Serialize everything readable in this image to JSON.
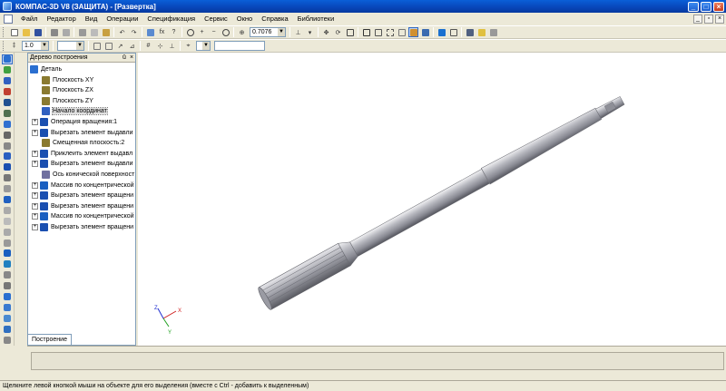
{
  "window": {
    "title": "КОМПАС-3D V8 (ЗАЩИТА) - [Развертка]"
  },
  "menu": {
    "items": [
      "Файл",
      "Редактор",
      "Вид",
      "Операции",
      "Спецификация",
      "Сервис",
      "Окно",
      "Справка",
      "Библиотеки"
    ]
  },
  "toolbar": {
    "zoom_value": "0.7076",
    "step_value": "1.0"
  },
  "tree": {
    "title": "Дерево построения",
    "items": [
      {
        "label": "Деталь",
        "icon": "part-icon",
        "color": "#2a6fd0"
      },
      {
        "label": "Плоскость XY",
        "icon": "plane-icon",
        "color": "#8a7a30"
      },
      {
        "label": "Плоскость ZX",
        "icon": "plane-icon",
        "color": "#8a7a30"
      },
      {
        "label": "Плоскость ZY",
        "icon": "plane-icon",
        "color": "#8a7a30"
      },
      {
        "label": "Начало координат",
        "icon": "origin-icon",
        "color": "#3060c0"
      },
      {
        "label": "Операция вращения:1",
        "icon": "revolve-icon",
        "color": "#1a4fb0"
      },
      {
        "label": "Вырезать элемент выдавли",
        "icon": "cut-extrude-icon",
        "color": "#1a4fb0"
      },
      {
        "label": "Смещенная плоскость:2",
        "icon": "plane-icon",
        "color": "#8a7a30"
      },
      {
        "label": "Приклеить элемент выдавл",
        "icon": "extrude-icon",
        "color": "#1a4fb0"
      },
      {
        "label": "Вырезать элемент выдавли",
        "icon": "cut-extrude-icon",
        "color": "#1a4fb0"
      },
      {
        "label": "Ось конической поверхност",
        "icon": "axis-icon",
        "color": "#7070a0"
      },
      {
        "label": "Массив по концентрической",
        "icon": "pattern-icon",
        "color": "#1a5fc0"
      },
      {
        "label": "Вырезать элемент вращени",
        "icon": "cut-revolve-icon",
        "color": "#1a4fb0"
      },
      {
        "label": "Вырезать элемент вращени",
        "icon": "cut-revolve-icon",
        "color": "#1a4fb0"
      },
      {
        "label": "Массив по концентрической",
        "icon": "pattern-icon",
        "color": "#1a5fc0"
      },
      {
        "label": "Вырезать элемент вращени",
        "icon": "cut-revolve-icon",
        "color": "#1a4fb0"
      }
    ],
    "tab_label": "Построение"
  },
  "axes": {
    "x": "X",
    "y": "Y",
    "z": "Z"
  },
  "status": {
    "hint": "Щелкните левой кнопкой мыши на объекте для его выделения (вместе с Ctrl - добавить к выделенным)"
  }
}
